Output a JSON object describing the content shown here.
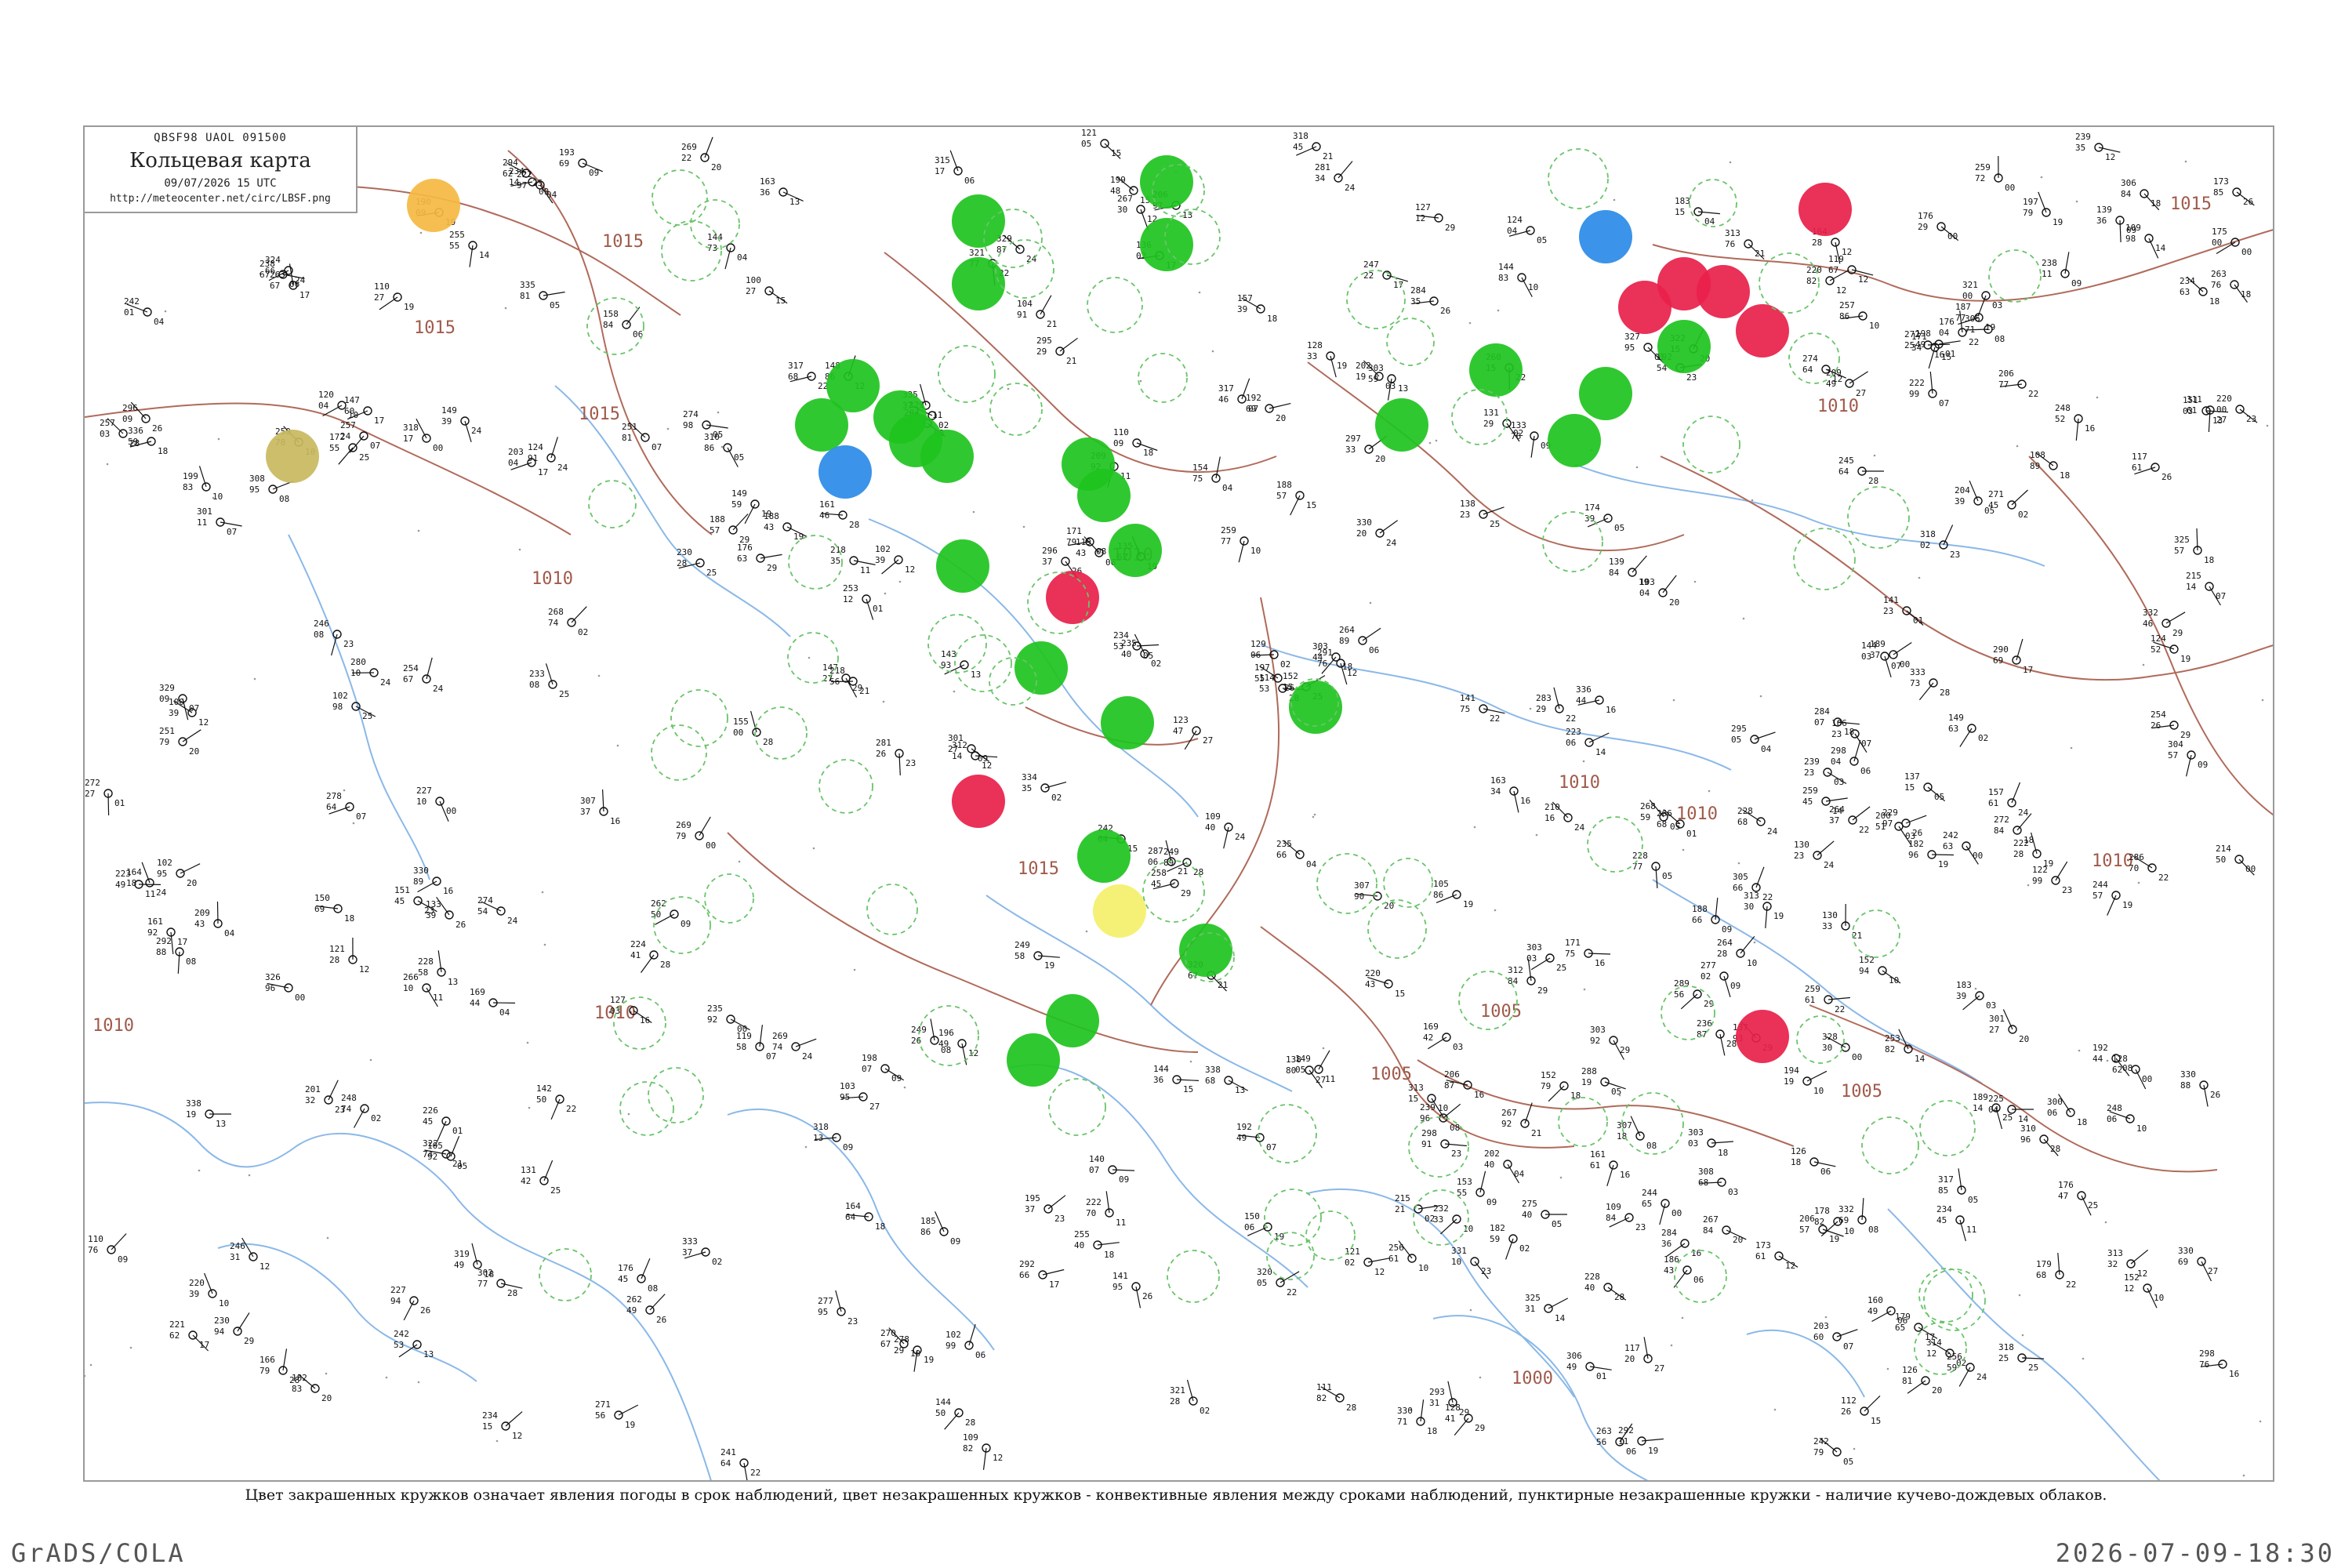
{
  "header": {
    "code_line": "QBSF98  UAOL  091500",
    "title": "Кольцевая карта",
    "datetime": "09/07/2026 15 UTC",
    "url": "http://meteocenter.net/circ/LBSF.png"
  },
  "caption": "Цвет закрашенных кружков означает явления погоды в срок наблюдений, цвет незакрашенных кружков - конвективные явления между сроками наблюдений, пунктирные незакрашенные кружки - наличие кучево-дождевых облаков.",
  "footer": {
    "left": "GrADS/COLA",
    "right": "2026-07-09-18:30"
  },
  "colors": {
    "thunderstorm_green": "#1ec31e",
    "rain_red": "#e8204a",
    "hail_blue": "#2a8ae8",
    "dust_orange": "#f5b942",
    "fog_olive": "#c9b860",
    "haze_yellow": "#f4f06a",
    "cb_dashed": "#6ac46a",
    "isobar": "#b06a5a",
    "coast": "#8ab8e8"
  },
  "isobar_labels": [
    "1015",
    "1015",
    "1015",
    "1010",
    "1015",
    "1010",
    "1010",
    "1010",
    "1010",
    "1015",
    "1010",
    "1005",
    "1005",
    "1005",
    "1010",
    "1010",
    "1000"
  ],
  "map_note": "simplified"
}
